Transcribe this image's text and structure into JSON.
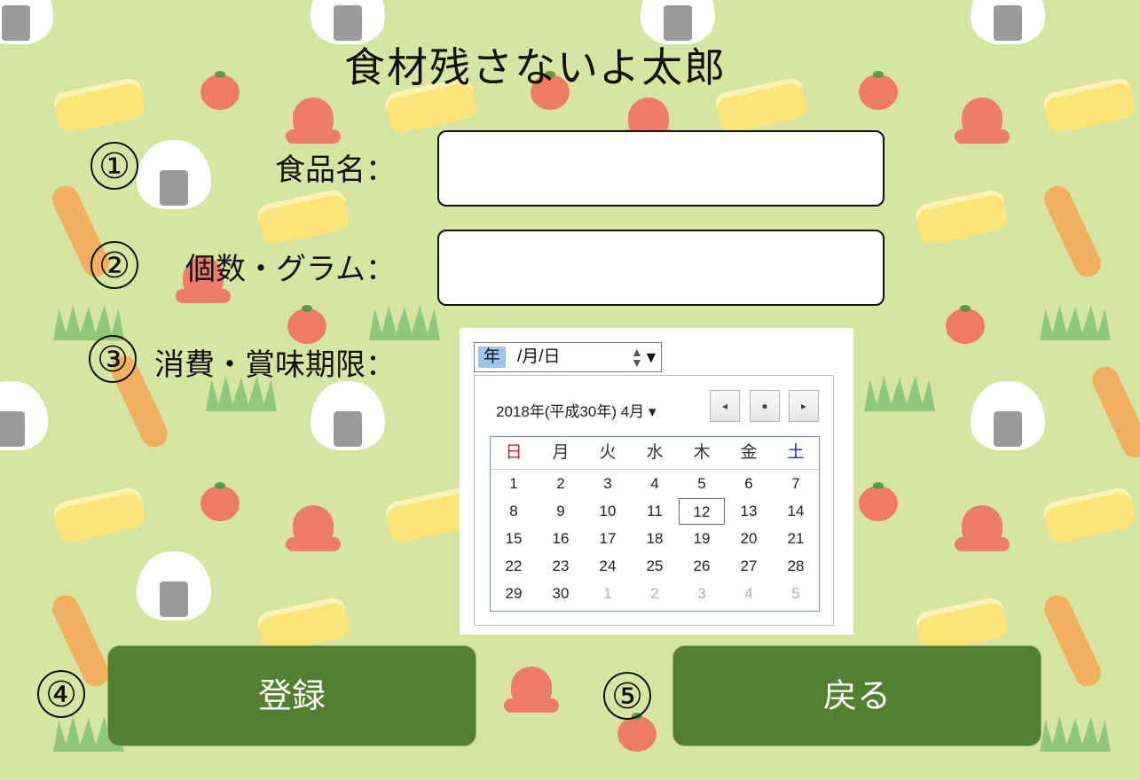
{
  "app": {
    "title": "食材残さないよ太郎"
  },
  "fields": [
    {
      "number": "①",
      "label": "食品名：",
      "value": ""
    },
    {
      "number": "②",
      "label": "個数・グラム：",
      "value": ""
    },
    {
      "number": "③",
      "label": "消費・賞味期限："
    }
  ],
  "date_input": {
    "year_segment": "年",
    "rest": "/月/日",
    "spinner": "▲▼",
    "dropdown": "▼"
  },
  "calendar": {
    "month_label": "2018年(平成30年) 4月 ▾",
    "nav": {
      "prev": "◂",
      "today": "●",
      "next": "▸"
    },
    "weekdays": [
      "日",
      "月",
      "火",
      "水",
      "木",
      "金",
      "土"
    ],
    "weeks": [
      [
        "1",
        "2",
        "3",
        "4",
        "5",
        "6",
        "7"
      ],
      [
        "8",
        "9",
        "10",
        "11",
        "12",
        "13",
        "14"
      ],
      [
        "15",
        "16",
        "17",
        "18",
        "19",
        "20",
        "21"
      ],
      [
        "22",
        "23",
        "24",
        "25",
        "26",
        "27",
        "28"
      ],
      [
        "29",
        "30",
        "1",
        "2",
        "3",
        "4",
        "5"
      ]
    ],
    "today": "12",
    "colors": {
      "sunday": "#d02020",
      "saturday": "#2020c0",
      "outside_month": "#b0b0b0"
    }
  },
  "buttons": [
    {
      "number": "④",
      "label": "登録"
    },
    {
      "number": "⑤",
      "label": "戻る"
    }
  ],
  "colors": {
    "background": "#d7e5a2",
    "button": "#527f30"
  }
}
